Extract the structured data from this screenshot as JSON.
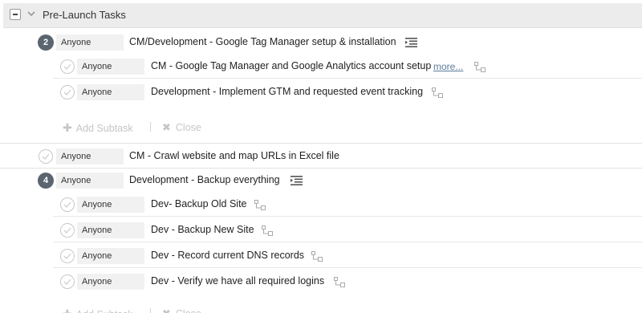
{
  "section": {
    "title": "Pre-Launch Tasks"
  },
  "add_subtask_label": "Add Subtask",
  "close_label": "Close",
  "tasks": [
    {
      "badge": "2",
      "assignee": "Anyone",
      "title": "CM/Development - Google Tag Manager setup & installation",
      "has_subtasks_icon": true
    },
    {
      "assignee": "Anyone",
      "title": "CM - Google Tag Manager and Google Analytics account setup",
      "more": "more..."
    },
    {
      "assignee": "Anyone",
      "title": "Development - Implement GTM and requested event tracking"
    },
    {
      "assignee": "Anyone",
      "title": "CM - Crawl website and map URLs in Excel file"
    },
    {
      "badge": "4",
      "assignee": "Anyone",
      "title": "Development - Backup everything",
      "has_subtasks_icon": true
    },
    {
      "assignee": "Anyone",
      "title": "Dev- Backup Old Site"
    },
    {
      "assignee": "Anyone",
      "title": "Dev - Backup New Site"
    },
    {
      "assignee": "Anyone",
      "title": "Dev - Record current DNS records"
    },
    {
      "assignee": "Anyone",
      "title": "Dev - Verify we have all required logins"
    }
  ],
  "icons": {
    "collapse": "minus-square-icon",
    "chevron": "chevron-down-icon",
    "subtasks": "subtask-list-icon",
    "dependency": "dependency-icon",
    "check": "checkmark-icon",
    "plus": "plus-icon",
    "close": "close-x-icon"
  }
}
